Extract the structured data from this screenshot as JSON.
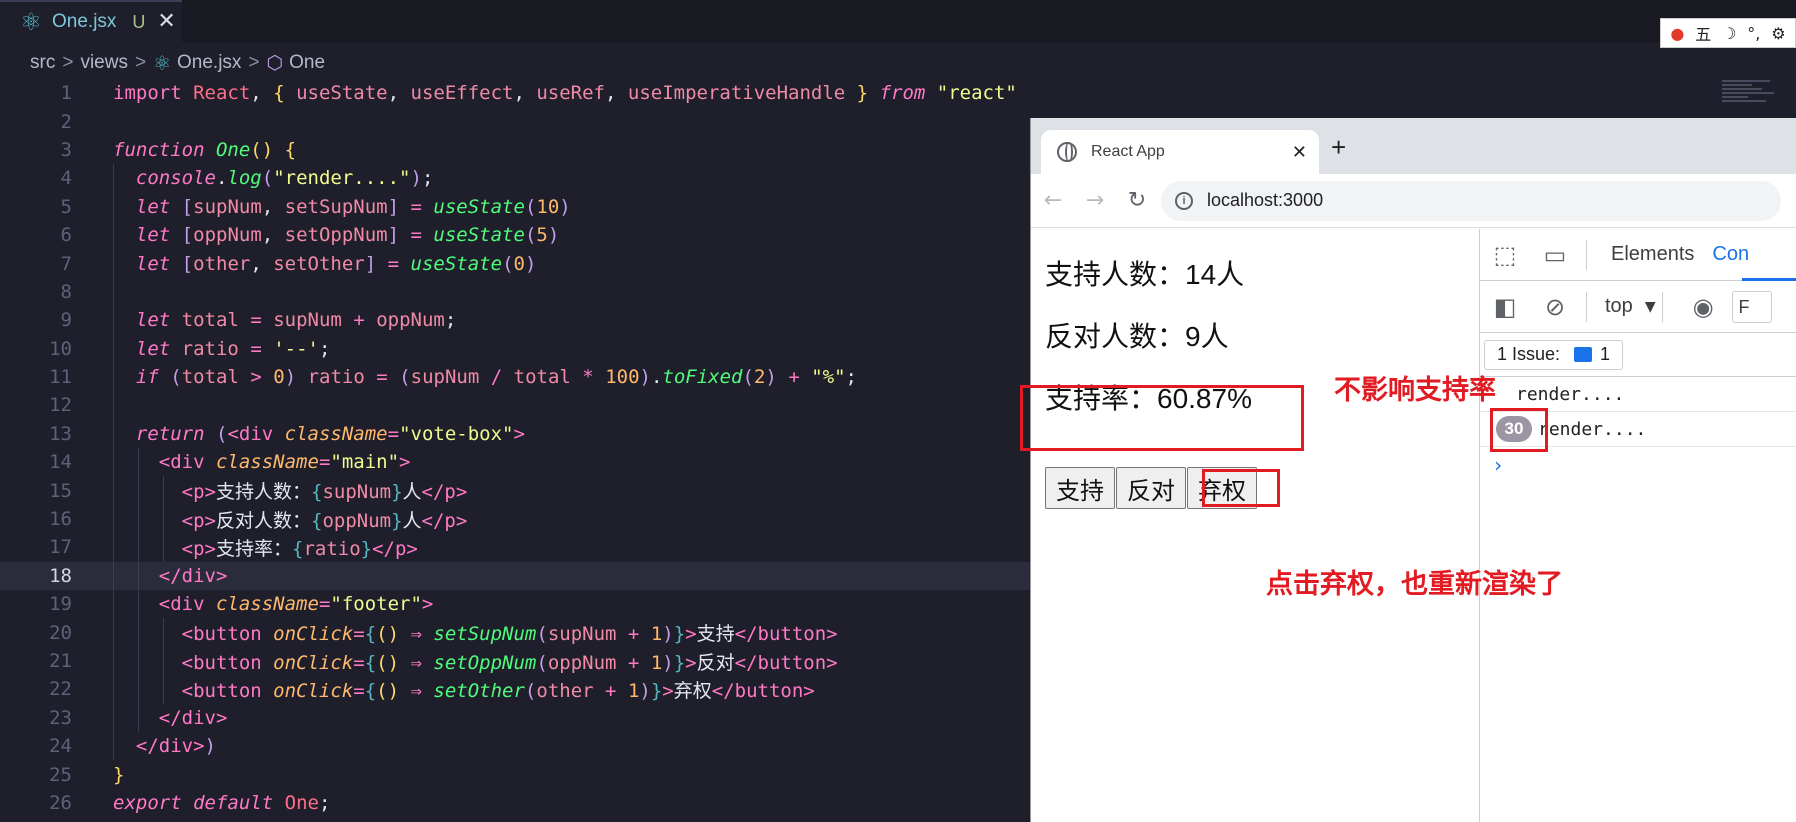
{
  "editor": {
    "tab": {
      "filename": "One.jsx",
      "badge": "U",
      "close": "✕"
    },
    "breadcrumb": [
      "src",
      "views",
      "One.jsx",
      "One"
    ],
    "active_line": 18
  },
  "tray": {
    "glyphs": [
      "五",
      "☽",
      "°,",
      "⚙"
    ]
  },
  "browser": {
    "tab_title": "React App",
    "tab_close": "✕",
    "new_tab": "+",
    "url": "localhost:3000",
    "page": {
      "support_line": "支持人数：14人",
      "oppose_line": "反对人数：9人",
      "ratio_line": "支持率：60.87%",
      "buttons": [
        "支持",
        "反对",
        "弃权"
      ]
    },
    "devtools": {
      "tabs": [
        "Elements",
        "Con"
      ],
      "context": "top",
      "filter": "F",
      "issues_label": "1 Issue:",
      "issues_count": "1",
      "logs": [
        {
          "count": "",
          "text": "render...."
        },
        {
          "count": "30",
          "text": "render...."
        }
      ],
      "prompt": "›"
    }
  },
  "annotations": {
    "ratio_note": "不影响支持率",
    "abstain_note": "点击弃权，也重新渲染了"
  }
}
